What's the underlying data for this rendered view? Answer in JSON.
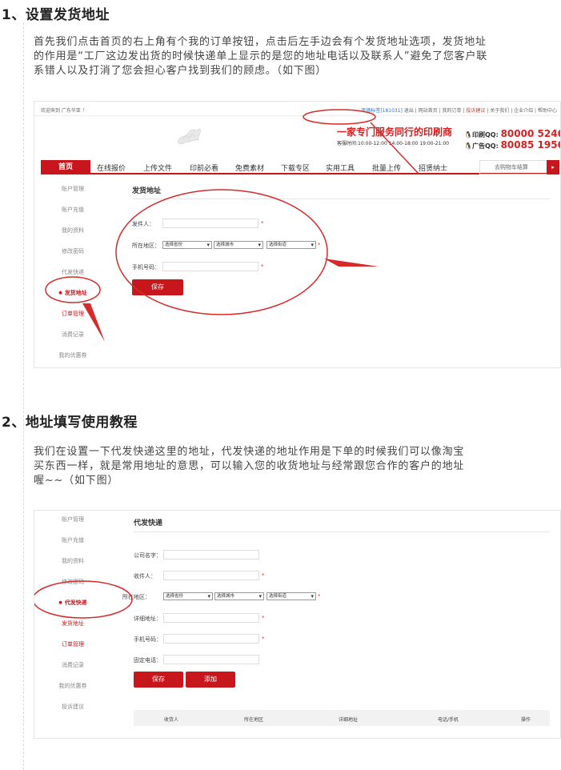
{
  "section1": {
    "title": "1、设置发货地址",
    "paragraph_lines": [
      "首先我们点击首页的右上角有个我的订单按钮，点击后左手边会有个发货地址选项，发货地址",
      "的作用是“工厂这边发出货的时候快递单上显示的是您的地址电话以及联系人”避免了您客户联",
      "系错人以及打消了您会担心客户找到我们的顾虑。（如下图）"
    ]
  },
  "section2": {
    "title": "2、地址填写使用教程",
    "paragraph_lines": [
      "我们在设置一下代发快递这里的地址，代发快递的地址作用是下单的时候我们可以像淘宝",
      "买东西一样，就是常用地址的意思，可以输入您的收货地址与经常跟您合作的客户的地址",
      "喔~~（如下图）"
    ]
  },
  "shot1": {
    "topbar_left": "欢迎来到 广东华亚 ！",
    "topbar_user": "平德标签[181031]",
    "topbar_links": [
      "退出",
      "网站首页",
      "我的订单",
      "投诉建议",
      "关于我们",
      "企业介绍",
      "帮助中心"
    ],
    "slogan": "一家专门服务同行的印刷商",
    "hours": "客服时间:10:00-12:00  14:00-18:00  19:00-21:00",
    "qq1_label": "印刷QQ:",
    "qq1_num": "80000 5246",
    "qq2_label": "广告QQ:",
    "qq2_num": "80085 1956",
    "nav": [
      "首页",
      "在线报价",
      "上传文件",
      "印前必看",
      "免费素材",
      "下载专区",
      "实用工具",
      "批量上传",
      "招贤纳士"
    ],
    "cart": "去购物车结算",
    "cart_arrow": "▸",
    "sidebar": [
      "账户管理",
      "账户充值",
      "我的资料",
      "修改密码",
      "代发快递",
      "发货地址",
      "订单管理",
      "消费记录",
      "我的优惠券"
    ],
    "panel_title": "发货地址",
    "labels": {
      "sender": "发件人：",
      "region": "所在地区：",
      "phone": "手机号码："
    },
    "select_province": "选择省份",
    "select_city": "选择城市",
    "select_street": "选择街道",
    "star": "*",
    "save": "保存"
  },
  "shot2": {
    "sidebar": [
      "账户管理",
      "账户充值",
      "我的资料",
      "修改密码",
      "代发快递",
      "发货地址",
      "订单管理",
      "消费记录",
      "我的优惠券",
      "投诉建议"
    ],
    "panel_title": "代发快递",
    "labels": {
      "company": "公司名字：",
      "receiver": "收件人：",
      "region": "所在地区：",
      "address": "详细地址：",
      "phone": "手机号码：",
      "tel": "固定电话："
    },
    "select_province": "选择省份",
    "select_city": "选择城市",
    "select_street": "选择街道",
    "star": "*",
    "save": "保存",
    "add": "添加",
    "table_headers": [
      "收货人",
      "所在地区",
      "详细地址",
      "电话/手机",
      "操作"
    ]
  },
  "colors": {
    "brand_red": "#c8161d",
    "annotation_red": "#d62b2b",
    "link_blue": "#2a76c6"
  }
}
